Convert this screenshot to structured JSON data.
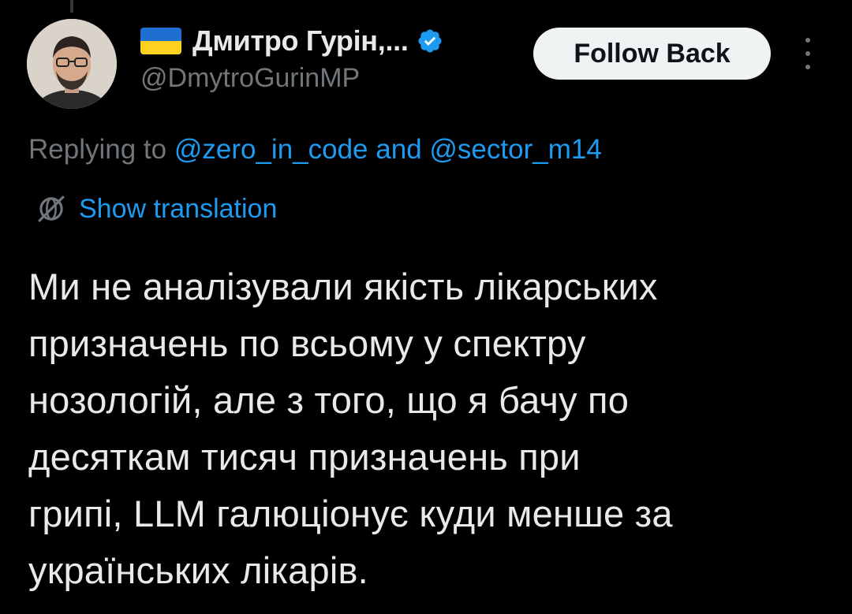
{
  "author": {
    "flag_colors": [
      "#1f6fd1",
      "#ffd21f"
    ],
    "display_name": "Дмитро Гурін,...",
    "handle": "@DmytroGurinMP",
    "verified_color": "#1d9bf0"
  },
  "actions": {
    "follow_label": "Follow Back",
    "more_icon": "more-vertical-icon"
  },
  "reply": {
    "prefix": "Replying to",
    "mentions": [
      "@zero_in_code",
      "@sector_m14"
    ],
    "joiner": "and"
  },
  "translation": {
    "icon": "globe-translate-icon",
    "label": "Show translation"
  },
  "tweet": {
    "lines": [
      "Ми не аналізували якість лікарських",
      "призначень по всьому у спектру",
      "нозологій, але з того, що я бачу по",
      "десяткам тисяч призначень при",
      "грипі, LLM галюціонує куди менше за",
      "українських лікарів."
    ]
  },
  "colors": {
    "background": "#000000",
    "text": "#e7e9ea",
    "secondary": "#71767b",
    "accent": "#1d9bf0"
  }
}
